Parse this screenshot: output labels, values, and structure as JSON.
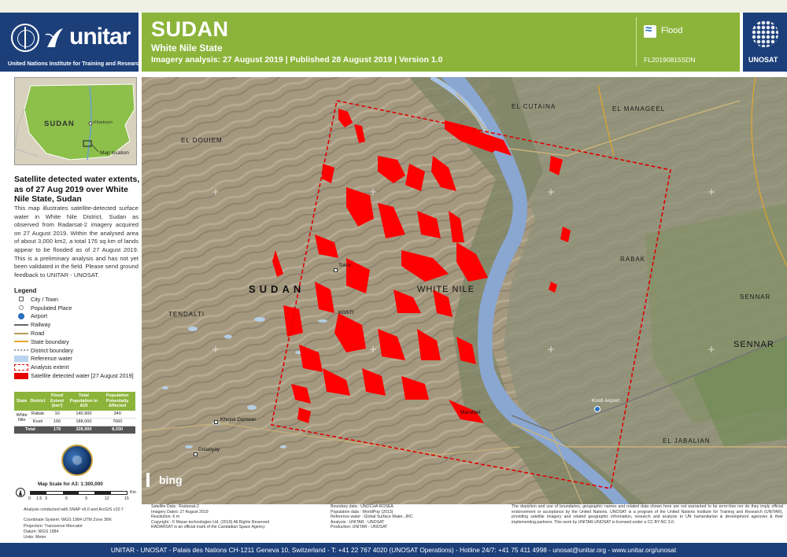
{
  "header": {
    "org_name": "unitar",
    "org_full": "United Nations Institute for Training and Research",
    "title": "SUDAN",
    "subtitle": "White Nile State",
    "info": "Imagery analysis: 27 August 2019 | Published 28 August 2019 | Version 1.0",
    "event": "Flood",
    "code": "FL20190815SDN",
    "partner": "UNOSAT"
  },
  "inset": {
    "country": "SUDAN",
    "capital": "Khartoum",
    "map_location": "Map location"
  },
  "panel": {
    "title": "Satellite detected water extents, as of 27 Aug 2019 over White Nile State, Sudan",
    "body": "This map illustrates satellite-detected surface water in White Nile District, Sudan as observed from Radarsat-2 imagery acquired on 27 August 2019. Within the analysed area of about 3,000 km2, a total 176 sq km of lands appear to be flooded as of 27 August 2019. This is a preliminary analysis and has not yet been validated in the field. Please send ground feedback to UNITAR - UNOSAT."
  },
  "legend": {
    "title": "Legend",
    "items": [
      {
        "label": "City / Town",
        "symbol": "town"
      },
      {
        "label": "Populated Place",
        "symbol": "place"
      },
      {
        "label": "Airport",
        "symbol": "airport"
      },
      {
        "label": "Railway",
        "symbol": "rail"
      },
      {
        "label": "Road",
        "symbol": "road"
      },
      {
        "label": "State boundary",
        "symbol": "state"
      },
      {
        "label": "District boundary",
        "symbol": "district"
      },
      {
        "label": "Reference water",
        "symbol": "water"
      },
      {
        "label": "Analysis extent",
        "symbol": "extent"
      },
      {
        "label": "Satellite detected water [27 August 2019]",
        "symbol": "flood"
      }
    ]
  },
  "table": {
    "headers": [
      "State",
      "District",
      "Flood Extent (km²)",
      "Total Population in AOI",
      "Population Potentially Affected"
    ],
    "state": "White Nile",
    "rows": [
      {
        "district": "Rabak",
        "flood": "10",
        "population": "140,900",
        "affected": "340"
      },
      {
        "district": "Kosti",
        "flood": "166",
        "population": "188,000",
        "affected": "7660"
      }
    ],
    "total": {
      "label": "Total",
      "flood": "176",
      "population": "328,900",
      "affected": "8,030"
    }
  },
  "scale": {
    "title": "Map Scale for A3: 1:300,000",
    "ticks": [
      "0",
      "1.5",
      "3",
      "6",
      "9",
      "12",
      "15"
    ],
    "unit": "Km"
  },
  "meta_left": [
    "Analysis conducted with SNAP v6.0 and ArcGIS v10.7",
    "",
    "Coordinate System: WGS 1984 UTM Zone 36N",
    "Projection: Transverse Mercator",
    "Datum: WGS 1984",
    "Units: Meter"
  ],
  "map": {
    "labels": {
      "sudan": "SUDAN",
      "white_nile": "WHITE NILE",
      "el_cutaina": "EL CUTAINA",
      "el_manageel": "EL MANAGEEL",
      "el_douiem": "EL DOUIEM",
      "rabak": "RABAK",
      "tendalti": "TENDALTI",
      "sennar_small": "SENNAR",
      "sennar_big": "SENNAR",
      "el_jabalian": "EL JABALIAN",
      "kosti": "KOSTI",
      "tokol": "Tokol",
      "marafeet": "Marafeet",
      "khojali": "Khojali Damwer",
      "dolabyay": "Dolabyay",
      "kosti_airport": "Kosti Airport",
      "bing": "bing"
    }
  },
  "meta_bottom": {
    "col1": [
      "Satellite Data : Radarsat-2",
      "Imagery Dates: 27 August 2019",
      "Resolution: 6 m",
      "Copyright : © Maxar technologies Ltd. (2019) All Rights Reserved",
      "RADARSAT is an official mark of the Candadian Space Agency"
    ],
    "col2": [
      "Boundary data : UNOCHA ROSEA",
      "Population data : WorldPop (2013)",
      "Reference water : Global Surface Water, JRC",
      "Analysis : UNITAR - UNOSAT",
      "Production: UNITAR - UNOSAT"
    ],
    "col3": "The depiction and use of boundaries, geographic names and related data shown here are not warranted to be error-free nor do they imply official endorsement or acceptance by the United Nations. UNOSAT is a program of the United Nations Institute for Training and Research (UNITAR), providing satellite imagery and related geographic information, research and analysis to UN humanitarian & development agencies & their implementing partners. This work by UNITAR-UNOSAT is licensed under a CC BY-NC 3.0."
  },
  "footer": "UNITAR - UNOSAT - Palais des Nations CH-1211 Geneva 10, Switzerland - T: +41 22 767 4020 (UNOSAT Operations) - Hotline 24/7: +41 75 411 4998 - unosat@unitar.org - www.unitar.org/unosat",
  "colors": {
    "header_green": "#8cb43a",
    "brand_blue": "#1c3f7a",
    "flood_red": "#e60000",
    "reference_water": "#b8d4ee"
  }
}
